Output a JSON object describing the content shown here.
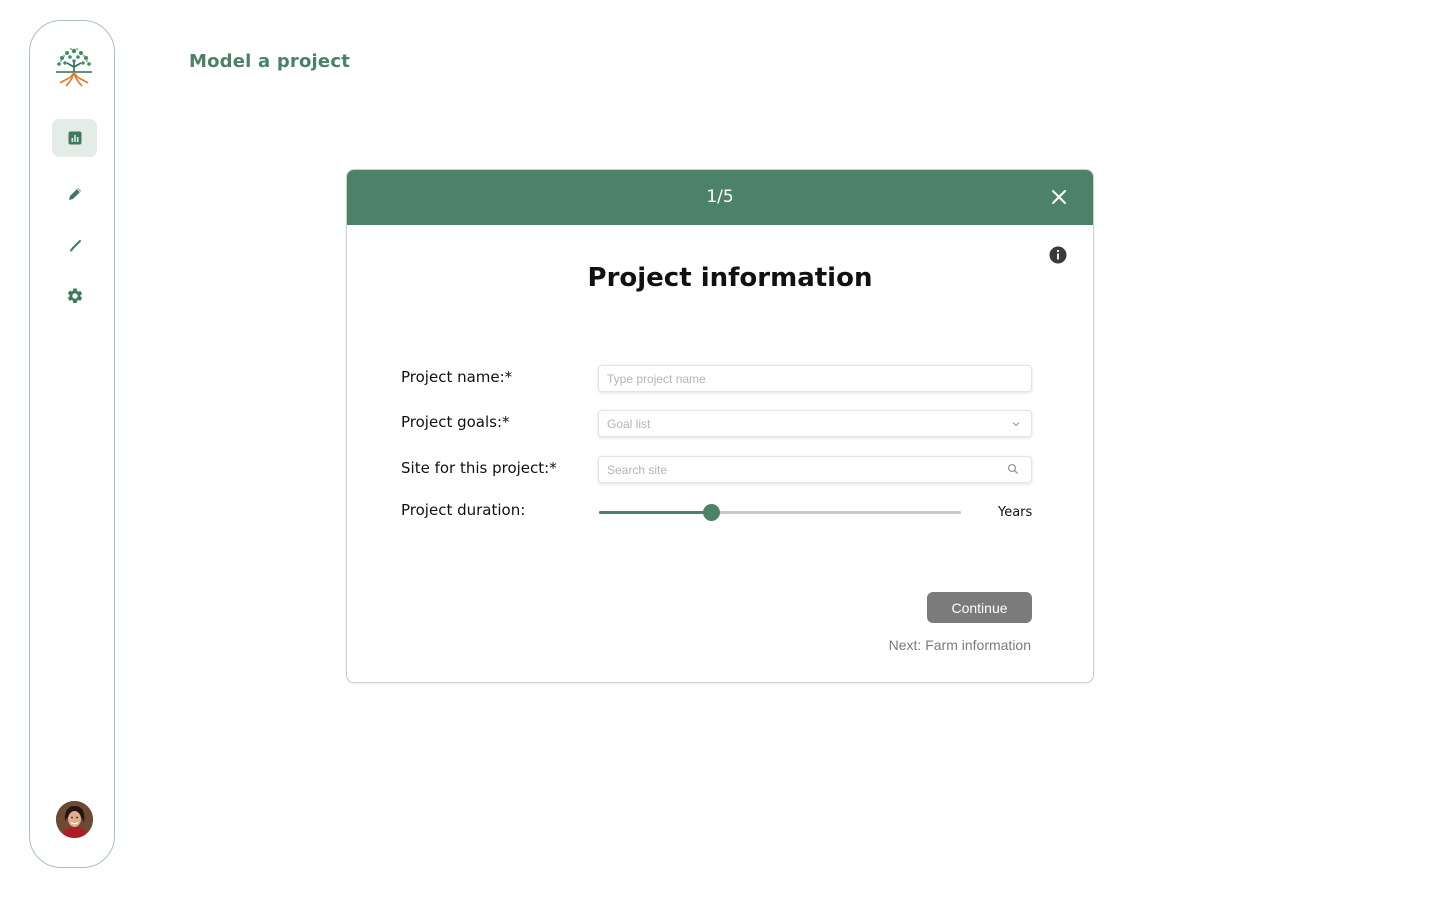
{
  "page": {
    "title": "Model a project"
  },
  "sidebar": {
    "items": [
      {
        "icon": "bar-chart-icon",
        "active": true
      },
      {
        "icon": "pencil-icon",
        "active": false
      },
      {
        "icon": "brush-icon",
        "active": false
      },
      {
        "icon": "gear-icon",
        "active": false
      }
    ]
  },
  "modal": {
    "step": "1/5",
    "title": "Project information",
    "fields": {
      "project_name": {
        "label": "Project name:*",
        "placeholder": "Type project name",
        "value": ""
      },
      "project_goals": {
        "label": "Project goals:*",
        "placeholder": "Goal list"
      },
      "site": {
        "label": "Site for this project:*",
        "placeholder": "Search site",
        "value": ""
      },
      "duration": {
        "label": "Project duration:",
        "unit": "Years",
        "slider_fraction": 0.31
      }
    },
    "continue_label": "Continue",
    "next_text": "Next: Farm information"
  },
  "colors": {
    "accent": "#4c8267",
    "title": "#4a8266",
    "button_disabled": "#7b7b7b"
  }
}
